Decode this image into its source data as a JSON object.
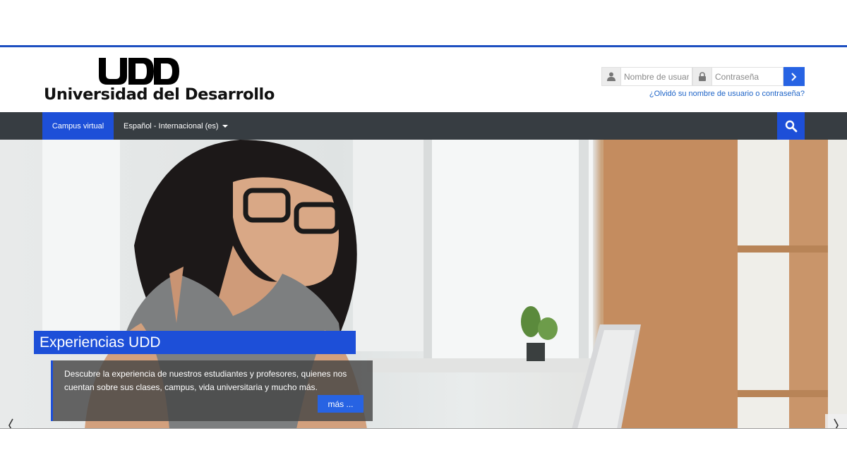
{
  "header": {
    "logo_mark": "UDD",
    "logo_text": "Universidad del Desarrollo",
    "login": {
      "username_placeholder": "Nombre de usuario",
      "password_placeholder": "Contraseña",
      "forgot_link": "¿Olvidó su nombre de usuario o contraseña?",
      "icons": [
        "user-icon",
        "lock-icon",
        "chevron-right-icon"
      ]
    }
  },
  "nav": {
    "home_label": "Campus virtual",
    "language_label": "Español - Internacional (es)",
    "search_icon": "search-icon"
  },
  "hero": {
    "title": "Experiencias UDD",
    "description": "Descubre la experiencia de nuestros estudiantes y profesores, quienes nos cuentan sobre sus clases, campus, vida universitaria y mucho más.",
    "more_label": "más ...",
    "prev_icon": "chevron-left-icon",
    "next_icon": "chevron-right-icon"
  },
  "colors": {
    "brand_blue": "#1d4fd8",
    "nav_bg": "#373d42",
    "link_blue": "#1d63c7"
  }
}
